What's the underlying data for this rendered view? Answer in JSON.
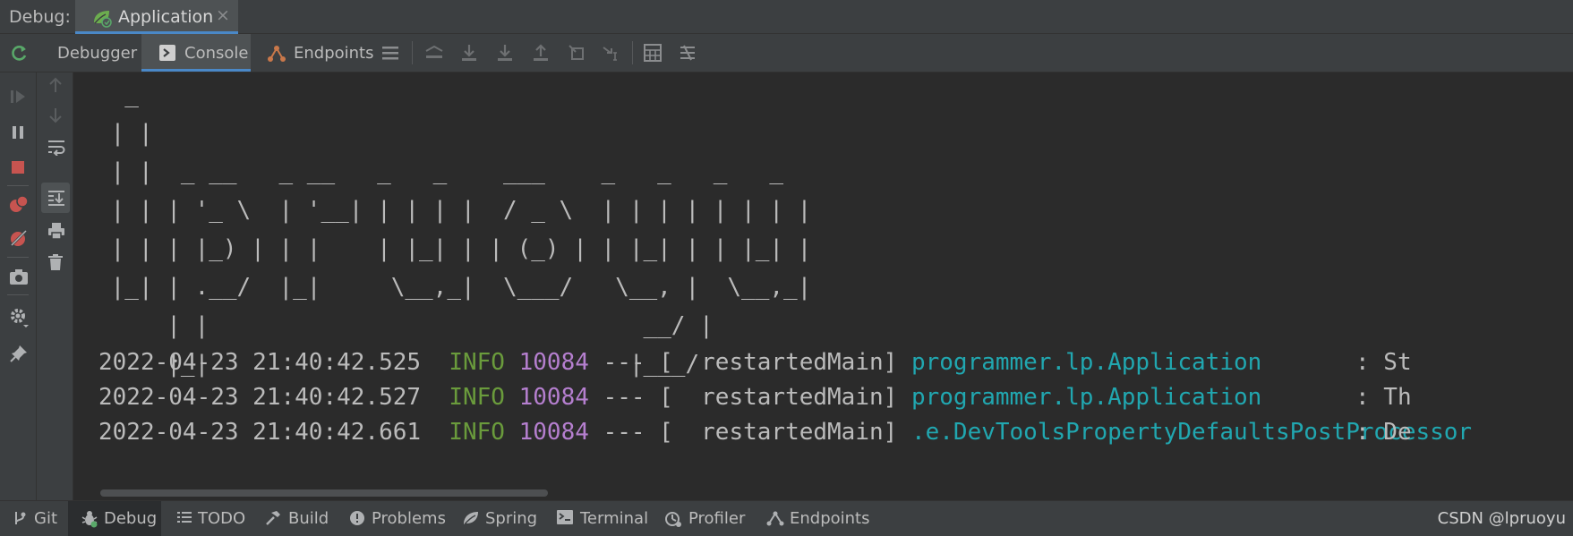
{
  "header": {
    "label": "Debug:",
    "app_tab": {
      "title": "Application",
      "close": "×"
    }
  },
  "toolbar": {
    "tabs": [
      {
        "label": "Debugger"
      },
      {
        "label": "Console"
      },
      {
        "label": "Endpoints"
      }
    ]
  },
  "console": {
    "banner": [
      "  _",
      " | |",
      " | |  _ __   _ __   _   _    ___    _   _   _   _",
      " | | | '_ \\  | '__| | | | |  / _ \\  | | | | | | | |",
      " | | | |_) | | |    | |_| | | (_) | | |_| | | |_| |",
      " |_| | .__/  |_|     \\__,_|  \\___/   \\__, |  \\__,_|",
      "     | |                               __/ |",
      "     |_|                              |___/"
    ],
    "logs": [
      {
        "timestamp": "2022-04-23 21:40:42.525",
        "level": "INFO",
        "pid": "10084",
        "sep": "--- [",
        "thread": "  restartedMain]",
        "logger": "programmer.lp.Application",
        "msg": ": St"
      },
      {
        "timestamp": "2022-04-23 21:40:42.527",
        "level": "INFO",
        "pid": "10084",
        "sep": "--- [",
        "thread": "  restartedMain]",
        "logger": "programmer.lp.Application",
        "msg": ": Th"
      },
      {
        "timestamp": "2022-04-23 21:40:42.661",
        "level": "INFO",
        "pid": "10084",
        "sep": "--- [",
        "thread": "  restartedMain]",
        "logger": ".e.DevToolsPropertyDefaultsPostProcessor",
        "msg": ": De"
      }
    ]
  },
  "bottom_bar": {
    "items": [
      {
        "label": "Git"
      },
      {
        "label": "Debug"
      },
      {
        "label": "TODO"
      },
      {
        "label": "Build"
      },
      {
        "label": "Problems"
      },
      {
        "label": "Spring"
      },
      {
        "label": "Terminal"
      },
      {
        "label": "Profiler"
      },
      {
        "label": "Endpoints"
      }
    ],
    "watermark": "CSDN @lpruoyu"
  },
  "colors": {
    "accent": "#4a88c7",
    "info": "#6a9b3c",
    "pid": "#b57fcf",
    "logger": "#21a7b0",
    "stop": "#c75450",
    "rerun": "#59a869"
  }
}
